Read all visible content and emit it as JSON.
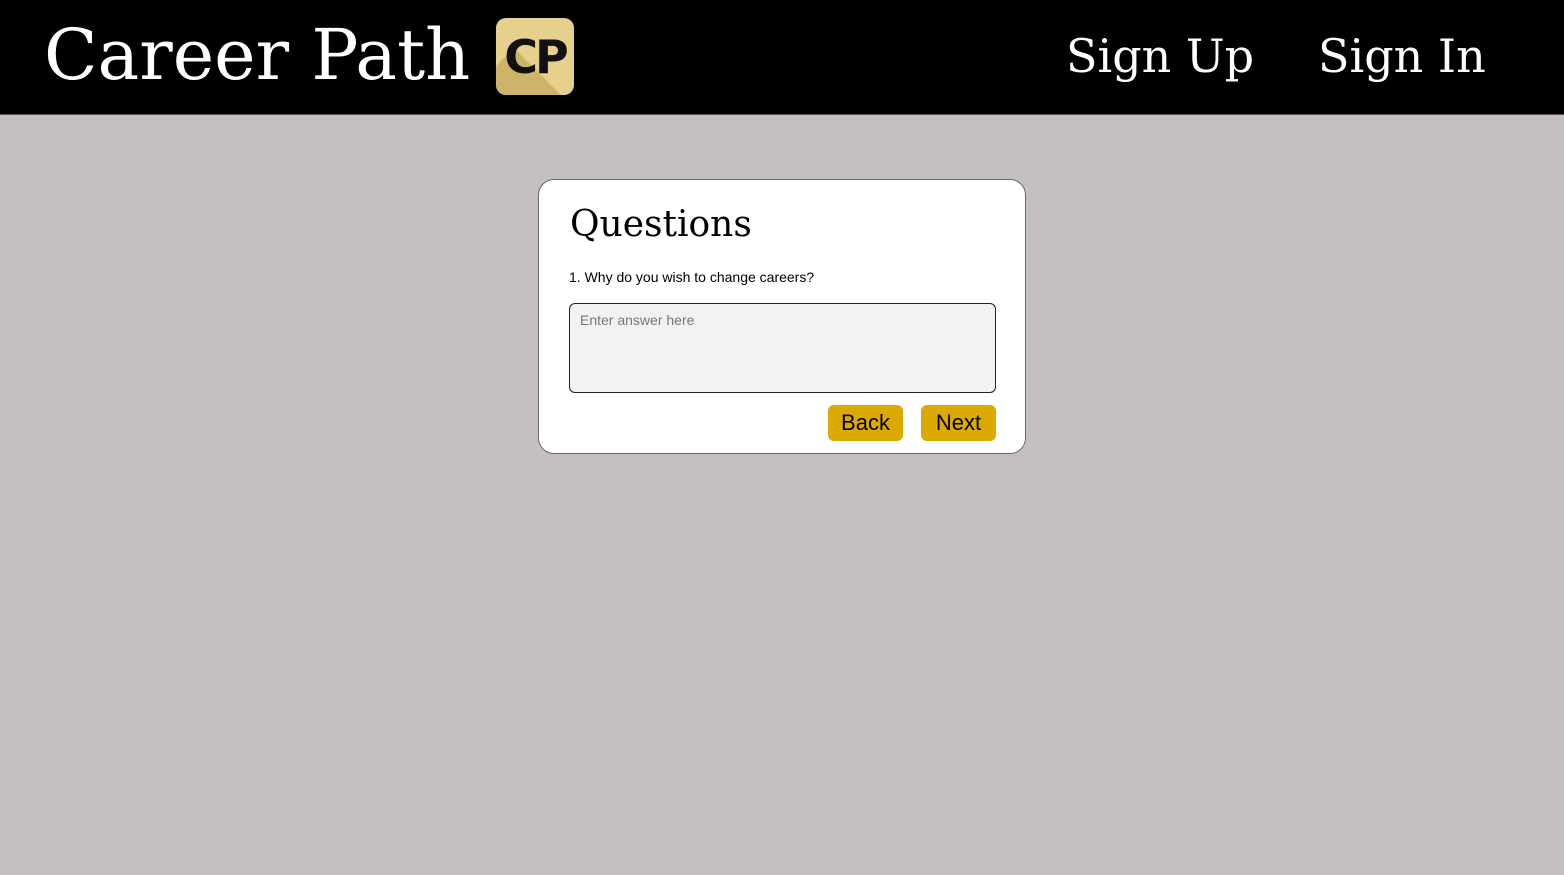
{
  "header": {
    "title": "Career Path",
    "logo_text": "CP",
    "nav": {
      "sign_up": "Sign Up",
      "sign_in": "Sign In"
    }
  },
  "questionnaire": {
    "heading": "Questions",
    "question": "1. Why do you wish to change careers?",
    "answer_placeholder": "Enter answer here",
    "answer_value": "",
    "back_label": "Back",
    "next_label": "Next"
  },
  "colors": {
    "header_bg": "#000000",
    "page_bg": "#c4c0c1",
    "button_bg": "#dba900",
    "logo_bg": "#e6d08e"
  }
}
